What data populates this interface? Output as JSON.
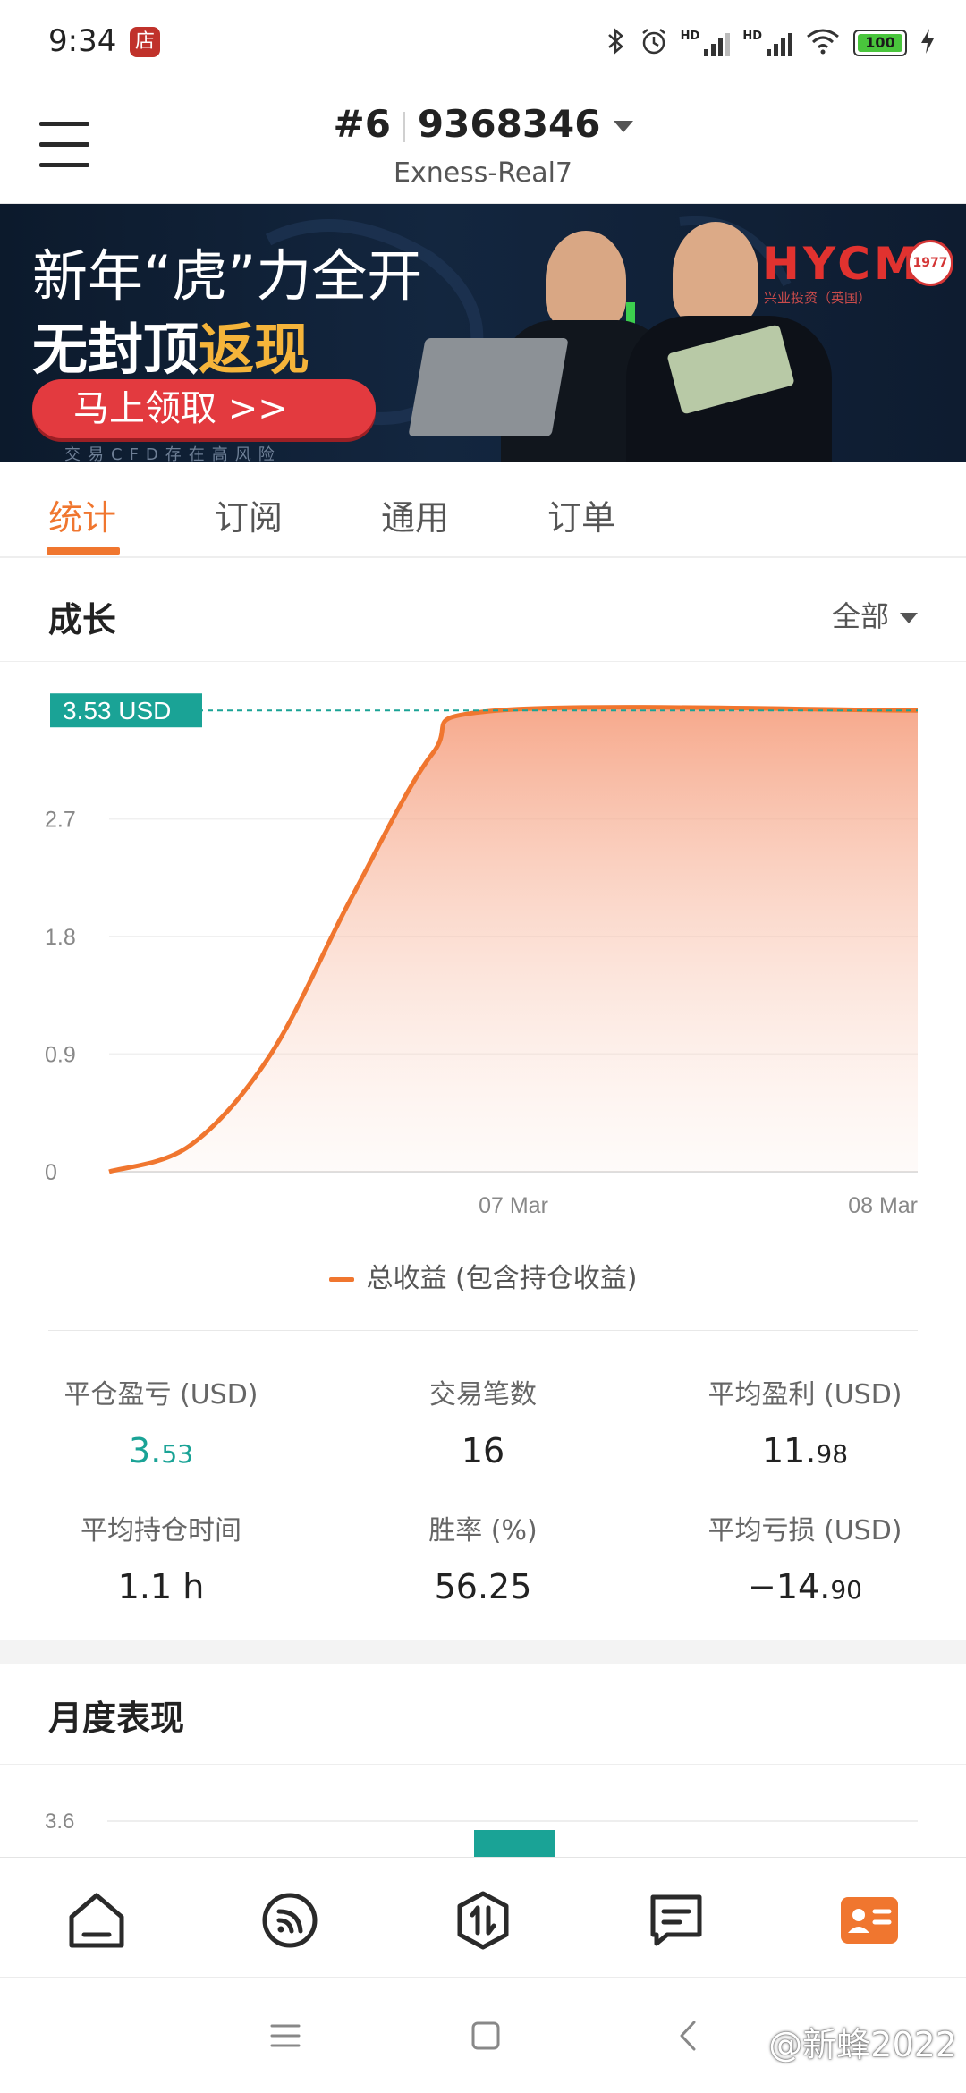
{
  "status_bar": {
    "time": "9:34",
    "store_badge": "店",
    "battery": "100"
  },
  "header": {
    "account_prefix": "#6",
    "account_number": "9368346",
    "server": "Exness-Real7"
  },
  "banner": {
    "line1": "新年“虎”力全开",
    "line2_prefix": "无封顶",
    "line2_highlight": "返现",
    "cta": "马上领取 >>",
    "risk_note": "交易CFD存在高风险",
    "brand": "HYCM",
    "brand_sub": "兴业投资（英国）",
    "seal": "1977"
  },
  "tabs": [
    {
      "label": "统计",
      "active": true
    },
    {
      "label": "订阅",
      "active": false
    },
    {
      "label": "通用",
      "active": false
    },
    {
      "label": "订单",
      "active": false
    }
  ],
  "growth": {
    "title": "成长",
    "filter": "全部",
    "current_tag": "3.53 USD",
    "legend": "总收益 (包含持仓收益)"
  },
  "chart_data": {
    "type": "area",
    "x_ticks": [
      "07 Mar",
      "08 Mar"
    ],
    "y_ticks": [
      "0",
      "0.9",
      "1.8",
      "2.7"
    ],
    "ylim": [
      0,
      3.6
    ],
    "series": [
      {
        "name": "总收益 (包含持仓收益)",
        "color": "#f0762f",
        "points": [
          [
            0,
            0
          ],
          [
            0.1,
            0.2
          ],
          [
            0.2,
            0.9
          ],
          [
            0.3,
            2.1
          ],
          [
            0.4,
            3.2
          ],
          [
            0.48,
            3.53
          ],
          [
            1.0,
            3.53
          ]
        ]
      }
    ],
    "reference_line": 3.53,
    "grid": true
  },
  "stats": [
    {
      "label": "平仓盈亏 (USD)",
      "value_main": "3.",
      "value_small": "53",
      "tone": "positive"
    },
    {
      "label": "交易笔数",
      "value_main": "16",
      "value_small": "",
      "tone": "neutral"
    },
    {
      "label": "平均盈利 (USD)",
      "value_main": "11.",
      "value_small": "98",
      "tone": "neutral"
    },
    {
      "label": "平均持仓时间",
      "value_main": "1.1 h",
      "value_small": "",
      "tone": "neutral"
    },
    {
      "label": "胜率 (%)",
      "value_main": "56.25",
      "value_small": "",
      "tone": "neutral"
    },
    {
      "label": "平均亏损 (USD)",
      "value_main": "−14.",
      "value_small": "90",
      "tone": "neutral"
    }
  ],
  "monthly": {
    "title": "月度表现",
    "y_tick": "3.6"
  },
  "bottom_nav": [
    {
      "name": "home-icon"
    },
    {
      "name": "signals-icon"
    },
    {
      "name": "trade-icon"
    },
    {
      "name": "messages-icon"
    },
    {
      "name": "account-card-icon",
      "active": true
    }
  ],
  "colors": {
    "accent": "#f0762f",
    "positive": "#1aa396"
  },
  "watermark": "@新蜂2022"
}
